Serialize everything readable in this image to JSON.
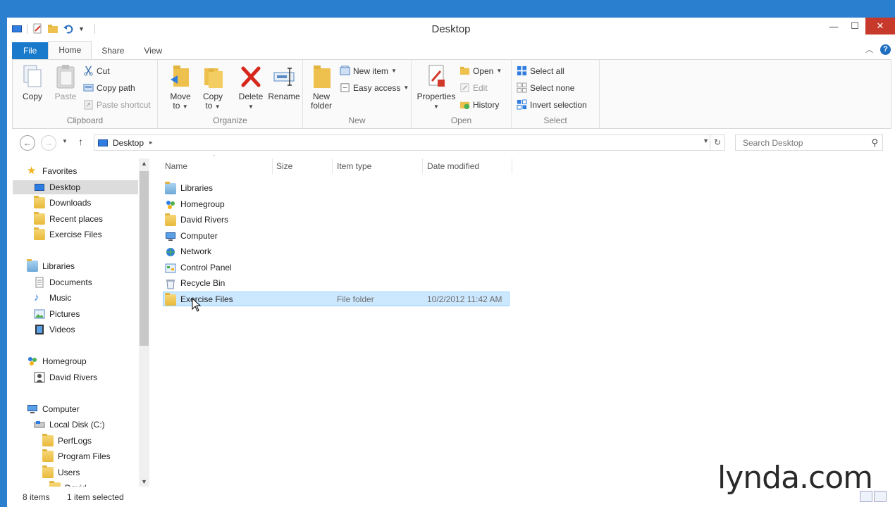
{
  "window": {
    "title": "Desktop",
    "controls": {
      "minimize": "—",
      "maximize": "☐",
      "close": "✕"
    }
  },
  "ribbon": {
    "tabs": [
      "File",
      "Home",
      "Share",
      "View"
    ],
    "active_tab": "Home",
    "help": "?",
    "groups": {
      "clipboard": {
        "label": "Clipboard",
        "copy": "Copy",
        "paste": "Paste",
        "cut": "Cut",
        "copy_path": "Copy path",
        "paste_shortcut": "Paste shortcut"
      },
      "organize": {
        "label": "Organize",
        "move_to_line1": "Move",
        "move_to_line2": "to",
        "copy_to_line1": "Copy",
        "copy_to_line2": "to",
        "delete": "Delete",
        "rename": "Rename"
      },
      "new": {
        "label": "New",
        "new_folder_line1": "New",
        "new_folder_line2": "folder",
        "new_item": "New item",
        "easy_access": "Easy access"
      },
      "open": {
        "label": "Open",
        "properties": "Properties",
        "open": "Open",
        "edit": "Edit",
        "history": "History"
      },
      "select": {
        "label": "Select",
        "select_all": "Select all",
        "select_none": "Select none",
        "invert_selection": "Invert selection"
      }
    }
  },
  "address": {
    "location": "Desktop",
    "search_placeholder": "Search Desktop"
  },
  "nav_pane": {
    "favorites": {
      "label": "Favorites",
      "items": [
        "Desktop",
        "Downloads",
        "Recent places",
        "Exercise Files"
      ],
      "selected": "Desktop"
    },
    "libraries": {
      "label": "Libraries",
      "items": [
        "Documents",
        "Music",
        "Pictures",
        "Videos"
      ]
    },
    "homegroup": {
      "label": "Homegroup",
      "items": [
        "David Rivers"
      ]
    },
    "computer": {
      "label": "Computer",
      "items": [
        "Local Disk (C:)"
      ],
      "subitems": [
        "PerfLogs",
        "Program Files",
        "Users",
        "David"
      ]
    }
  },
  "file_list": {
    "columns": [
      "Name",
      "Size",
      "Item type",
      "Date modified"
    ],
    "rows": [
      {
        "name": "Libraries",
        "type": "",
        "date": "",
        "icon": "libraries-icon"
      },
      {
        "name": "Homegroup",
        "type": "",
        "date": "",
        "icon": "homegroup-icon"
      },
      {
        "name": "David Rivers",
        "type": "",
        "date": "",
        "icon": "user-folder-icon"
      },
      {
        "name": "Computer",
        "type": "",
        "date": "",
        "icon": "computer-icon"
      },
      {
        "name": "Network",
        "type": "",
        "date": "",
        "icon": "network-icon"
      },
      {
        "name": "Control Panel",
        "type": "",
        "date": "",
        "icon": "control-panel-icon"
      },
      {
        "name": "Recycle Bin",
        "type": "",
        "date": "",
        "icon": "recycle-bin-icon"
      },
      {
        "name": "Exercise Files",
        "type": "File folder",
        "date": "10/2/2012 11:42 AM",
        "icon": "folder-icon",
        "selected": true
      }
    ]
  },
  "status": {
    "count": "8 items",
    "selection": "1 item selected"
  },
  "watermark": "lynda.com",
  "colors": {
    "accent": "#1979ca",
    "selection_bg": "#cce8ff",
    "selection_border": "#99d1ff",
    "close_button": "#c7392a"
  }
}
